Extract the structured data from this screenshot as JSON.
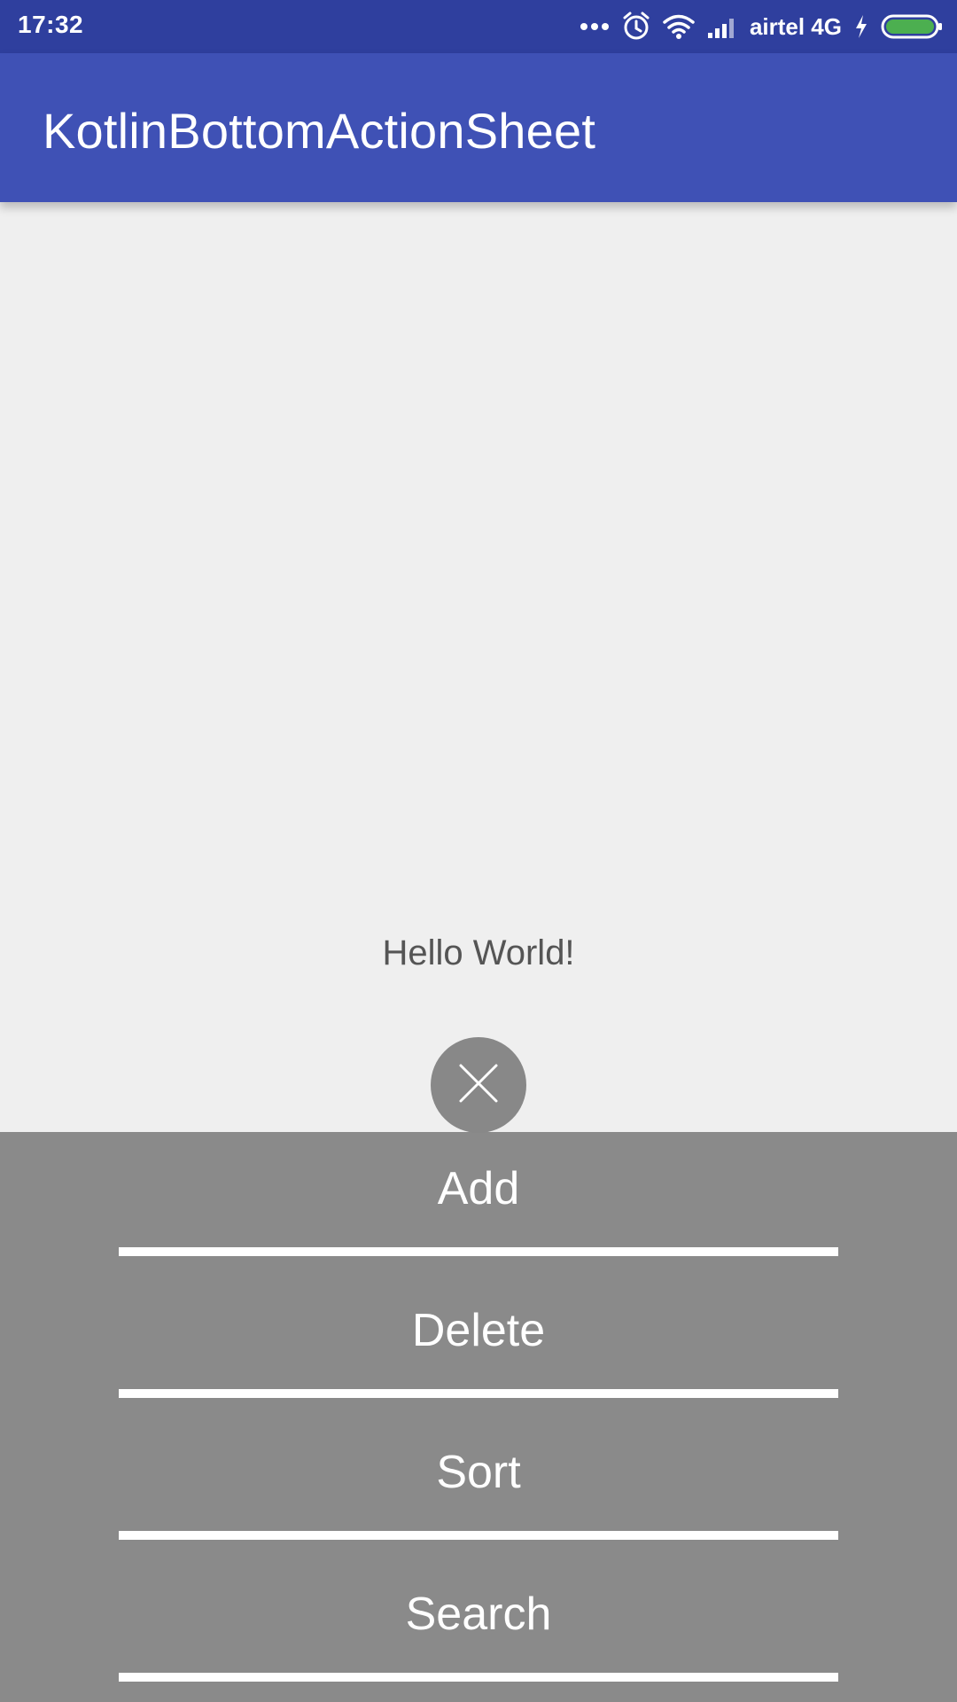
{
  "status_bar": {
    "time": "17:32",
    "carrier": "airtel 4G",
    "icons": [
      "more-dots-icon",
      "alarm-icon",
      "wifi-icon",
      "signal-icon",
      "charging-icon",
      "battery-icon"
    ],
    "battery_color": "#4caf50"
  },
  "app_bar": {
    "title": "KotlinBottomActionSheet",
    "color": "#3f51b5"
  },
  "content": {
    "text": "Hello World!"
  },
  "close_button": {
    "icon": "close-icon"
  },
  "action_sheet": {
    "items": [
      {
        "label": "Add"
      },
      {
        "label": "Delete"
      },
      {
        "label": "Sort"
      },
      {
        "label": "Search"
      }
    ],
    "background": "#8a8a8a"
  }
}
